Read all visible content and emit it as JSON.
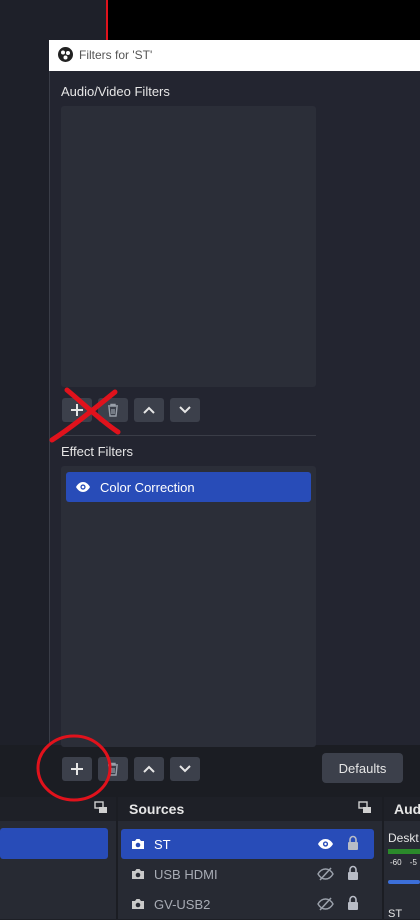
{
  "dialog": {
    "title": "Filters for 'ST'",
    "av_section_label": "Audio/Video Filters",
    "effect_section_label": "Effect Filters",
    "effect_filters": [
      {
        "label": "Color Correction",
        "visible": true,
        "selected": true
      }
    ],
    "defaults_label": "Defaults"
  },
  "sources_dock": {
    "title": "Sources",
    "items": [
      {
        "name": "ST",
        "visible": true,
        "locked": true,
        "selected": true
      },
      {
        "name": "USB HDMI",
        "visible": false,
        "locked": true,
        "selected": false
      },
      {
        "name": "GV-USB2",
        "visible": false,
        "locked": true,
        "selected": false
      }
    ]
  },
  "audio_dock": {
    "title": "Aud",
    "desktop_label": "Deskt",
    "scale_labels": [
      "-60",
      "-5"
    ],
    "st_label": "ST"
  },
  "colors": {
    "accent": "#284cb8",
    "annotation": "#e0121c",
    "background": "#1d1f26"
  },
  "icons": [
    "obs-logo-icon",
    "plus-icon",
    "trash-icon",
    "chevron-up-icon",
    "chevron-down-icon",
    "eye-icon",
    "eye-hidden-icon",
    "lock-icon",
    "camera-icon",
    "undock-icon"
  ]
}
